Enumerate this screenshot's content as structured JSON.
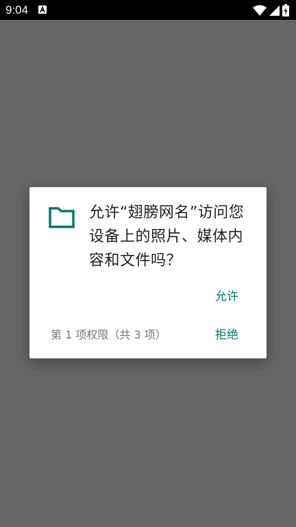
{
  "status_bar": {
    "time": "9:04",
    "notification_icon": "a-icon",
    "icons": [
      "wifi-icon",
      "cellular-signal-icon",
      "battery-charging-icon"
    ]
  },
  "dialog": {
    "icon": "folder-icon",
    "message": "允许“翅膀网名”访问您设备上的照片、媒体内容和文件吗？",
    "allow_label": "允许",
    "deny_label": "拒绝",
    "permission_counter": "第 1 项权限（共 3 项）"
  },
  "colors": {
    "accent": "#00796b",
    "scrim": "#666666",
    "status_bar": "#000000",
    "dialog_bg": "#ffffff",
    "message_text": "#212121",
    "counter_text": "#757575"
  }
}
